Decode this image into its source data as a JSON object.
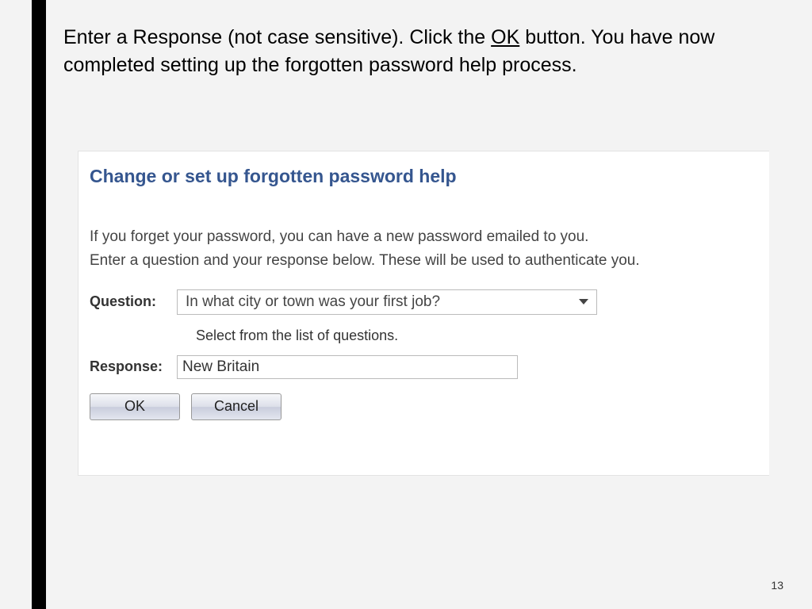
{
  "instruction": {
    "part1": "Enter a Response (not case sensitive).  Click the ",
    "ok_word": "OK",
    "part2": " button.  You have now completed setting up the forgotten password help process."
  },
  "form": {
    "title": "Change or set up forgotten password help",
    "desc_line1": "If you forget your password, you can have a new password emailed to you.",
    "desc_line2": "Enter a question and your response below. These will be used to authenticate you.",
    "question_label": "Question:",
    "question_value": "In what city or town was your first job?",
    "question_helper": "Select from the list of questions.",
    "response_label": "Response:",
    "response_value": "New Britain",
    "ok_label": "OK",
    "cancel_label": "Cancel"
  },
  "page_number": "13"
}
